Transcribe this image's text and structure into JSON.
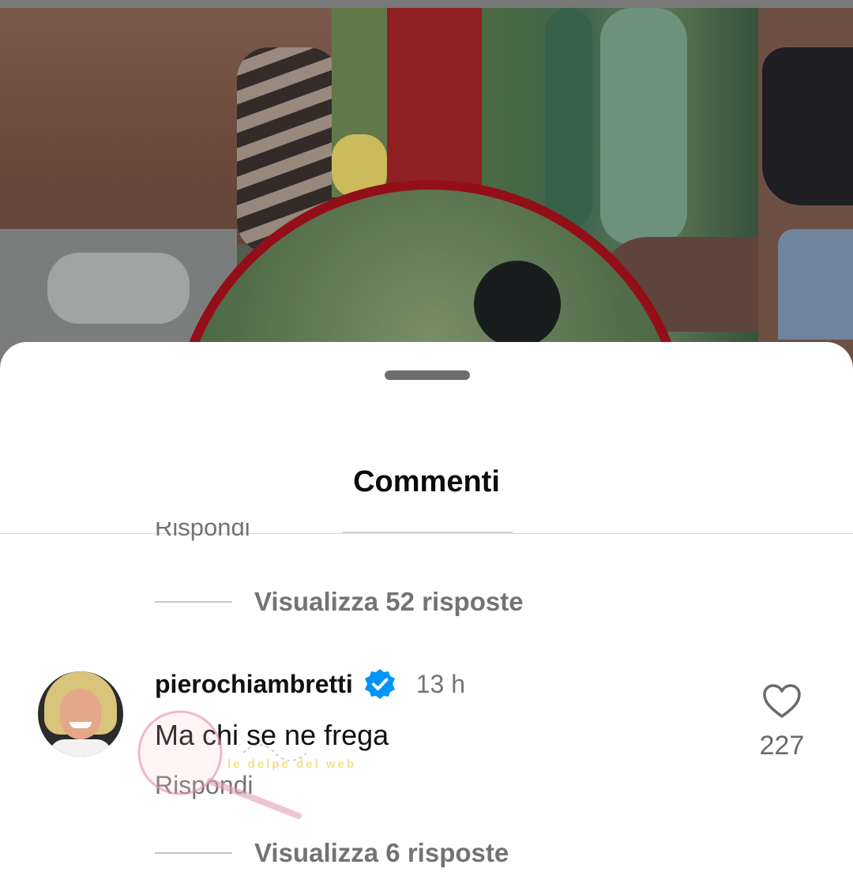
{
  "sheet": {
    "title": "Commenti"
  },
  "previous_comment": {
    "reply_label": "Rispondi",
    "view_replies_label": "Visualizza 52 risposte"
  },
  "comment": {
    "username": "pierochiambretti",
    "time": "13 h",
    "text": "Ma chi se ne frega",
    "reply_label": "Rispondi",
    "like_count": "227",
    "view_replies_label": "Visualizza 6 risposte"
  },
  "watermark": {
    "text": "le delpe del web"
  },
  "icons": {
    "verified": "verified-badge-icon",
    "like": "heart-outline-icon"
  },
  "colors": {
    "verified_blue": "#0095f6",
    "secondary_text": "#737373",
    "photo_accent_red": "#a8121c"
  }
}
